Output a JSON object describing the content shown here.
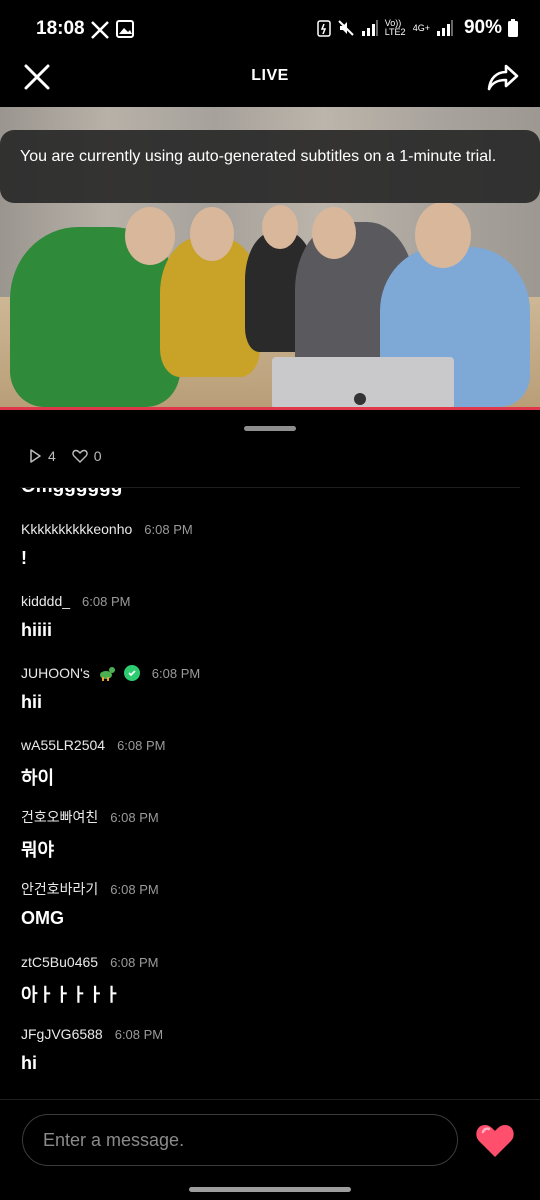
{
  "status_bar": {
    "time": "18:08",
    "network_label": "Vo)) LTE2",
    "network_label2": "4G+",
    "battery": "90%"
  },
  "header": {
    "title": "LIVE"
  },
  "video": {
    "subtitle_notice": "You are currently using auto-generated subtitles on a 1-minute trial."
  },
  "stats": {
    "views": "4",
    "likes": "0"
  },
  "chat": {
    "partial_text": "Omgggggg",
    "messages": [
      {
        "user": "Kkkkkkkkkkeonho",
        "time": "6:08 PM",
        "text": "!"
      },
      {
        "user": "kidddd_",
        "time": "6:08 PM",
        "text": "hiiii"
      },
      {
        "user": "JUHOON's",
        "time": "6:08 PM",
        "text": "hii"
      },
      {
        "user": "wA55LR2504",
        "time": "6:08 PM",
        "text": "하이"
      },
      {
        "user": "건호오빠여친",
        "time": "6:08 PM",
        "text": "뭐야"
      },
      {
        "user": "안건호바라기",
        "time": "6:08 PM",
        "text": "OMG"
      },
      {
        "user": "ztC5Bu0465",
        "time": "6:08 PM",
        "text": "아ㅏㅏㅏㅏㅏ"
      },
      {
        "user": "JFgJVG6588",
        "time": "6:08 PM",
        "text": "hi"
      }
    ]
  },
  "composer": {
    "placeholder": "Enter a message."
  },
  "colors": {
    "accent_red": "#e0384a",
    "heart": "#ff4f6d",
    "verified": "#2ecc71"
  }
}
